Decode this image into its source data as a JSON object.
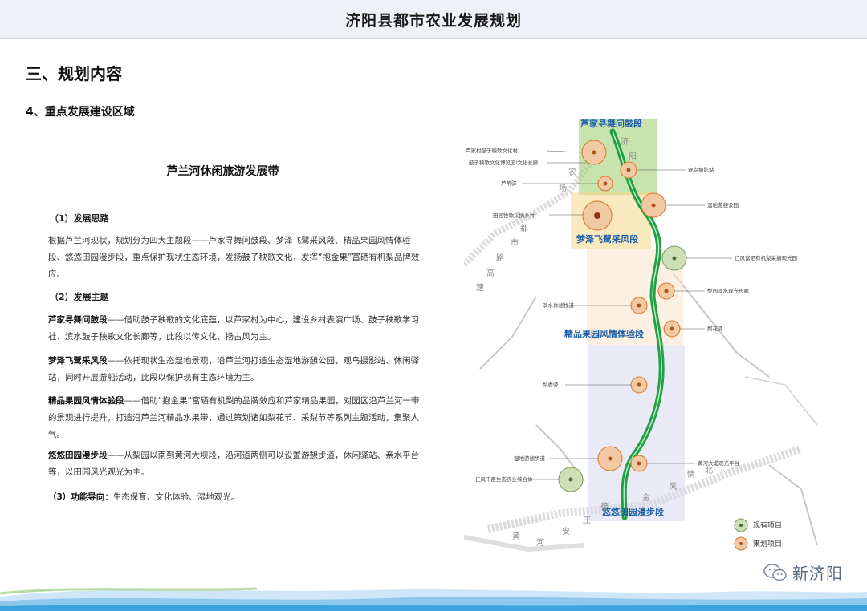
{
  "header": {
    "title": "济阳县都市农业发展规划"
  },
  "section": {
    "title": "三、规划内容",
    "subtitle": "4、重点发展建设区域"
  },
  "band": {
    "title": "芦兰河休闲旅游发展带"
  },
  "ideas": {
    "heading": "（1）发展思路",
    "text": "根据芦兰河现状，规划分为四大主题段——芦家寻舞问鼓段、梦泽飞鹭采风段、精品果园风情体验段、悠悠田园漫步段，重点保护现状生态环境，发扬鼓子秧歌文化，发挥“抱金果”富硒有机梨品牌效应。"
  },
  "themes": {
    "heading": "（2）发展主题",
    "items": [
      {
        "lead": "芦家寻舞问鼓段",
        "text": "——借助鼓子秧歌的文化底蕴，以芦家村为中心，建设乡村表演广场、鼓子秧歌学习社、滨水鼓子秧歌文化长廊等，此段以传文化、扬古风为主。"
      },
      {
        "lead": "梦泽飞鹭采风段",
        "text": "——依托现状生态湿地景观，沿芦兰河打造生态湿地游憩公园，观鸟摄影站、休闲驿站，同时开展游船活动，此段以保护现有生态环境为主。"
      },
      {
        "lead": "精品果园风情体验段",
        "text": "——借助“抱金果”富硒有机梨的品牌效应和芦家精品果园，对园区沿芦兰河一带的景观进行提升，打造沿芦兰河精品水果带，通过策划诸如梨花节、采梨节等系列主题活动，集聚人气。"
      },
      {
        "lead": "悠悠田园漫步段",
        "text": "——从梨园以南到黄河大坝段，沿河道两侧可以设置游憩步道，休闲驿站、亲水平台等，以田园风光观光为主。"
      }
    ]
  },
  "function": {
    "heading": "（3）功能导向",
    "text": "：生态保育、文化体验、湿地观光。"
  },
  "map": {
    "segments": [
      "芦家寻舞问鼓段",
      "梦泽飞鹭采风段",
      "精品果园风情体验段",
      "悠悠田园漫步段"
    ],
    "callouts_left": [
      "芦家村鼓子秧歌文化村",
      "鼓子秧歌文化博览园/文化长廊",
      "芦苇驿",
      "田园牧歌采摘乡村",
      "滨水休憩栈道",
      "梨香驿",
      "湿地游憩步道",
      "仁风千亩生态农业综合体"
    ],
    "callouts_right": [
      "观鸟摄影站",
      "湿地游憩公园",
      "仁风富硒有机梨采摘观光园",
      "梨园滨水观光长廊",
      "梨花驿",
      "黄河大堤观光平台"
    ],
    "road_labels": [
      "济",
      "阳",
      "农",
      "场",
      "都",
      "市",
      "路",
      "高",
      "速",
      "黄",
      "河",
      "风",
      "情",
      "金",
      "德",
      "北",
      "安",
      "庄"
    ],
    "legend": {
      "existing": "现有项目",
      "planned": "策划项目"
    },
    "colors": {
      "river": "#1fa043",
      "existing": "#7a9a5a",
      "planned": "#d9742a"
    }
  },
  "brand": {
    "name": "新济阳"
  }
}
